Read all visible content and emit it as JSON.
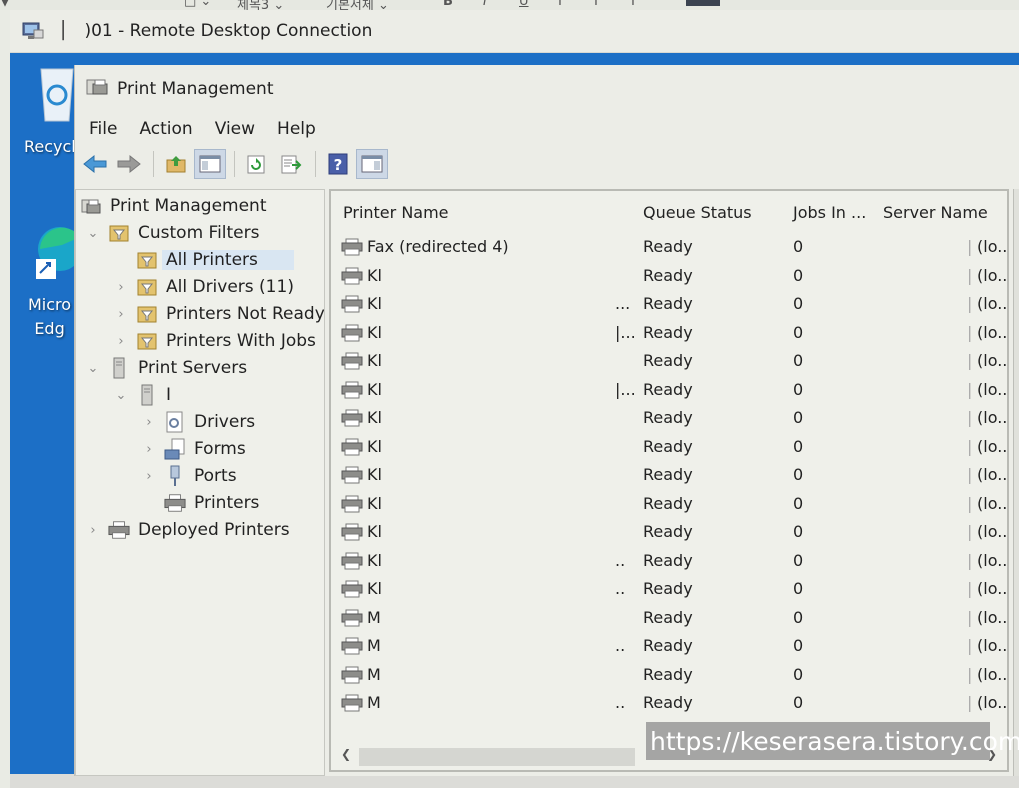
{
  "rdp": {
    "title": "│   )01 - Remote Desktop Connection"
  },
  "desktop": {
    "icons": [
      {
        "label": "Recycl"
      },
      {
        "label": "Micro\nEdg"
      }
    ]
  },
  "underlying_app": {
    "fragments": [
      "▼",
      "□ ⌄",
      "제목3 ⌄",
      "기본서체 ⌄",
      "B",
      "I",
      "U",
      "T",
      "T",
      "T"
    ]
  },
  "window": {
    "title": "Print Management",
    "menu": [
      "File",
      "Action",
      "View",
      "Help"
    ],
    "toolbar": [
      {
        "icon": "back-arrow-icon"
      },
      {
        "icon": "forward-arrow-icon"
      },
      {
        "icon": "up-folder-icon"
      },
      {
        "icon": "show-hide-console-tree-icon"
      },
      {
        "icon": "refresh-icon"
      },
      {
        "icon": "export-list-icon"
      },
      {
        "icon": "help-icon"
      },
      {
        "icon": "show-hide-action-pane-icon"
      }
    ]
  },
  "tree": [
    {
      "label": "Print Management",
      "level": 0,
      "chevron": "",
      "icon": "print-management-icon"
    },
    {
      "label": "Custom Filters",
      "level": 1,
      "chevron": "⌄",
      "icon": "filter-folder-icon"
    },
    {
      "label": "All Printers",
      "level": 2,
      "chevron": "",
      "icon": "filter-icon",
      "selected": true
    },
    {
      "label": "All Drivers (11)",
      "level": 2,
      "chevron": "›",
      "icon": "filter-icon"
    },
    {
      "label": "Printers Not Ready",
      "level": 2,
      "chevron": "›",
      "icon": "filter-icon"
    },
    {
      "label": "Printers With Jobs",
      "level": 2,
      "chevron": "›",
      "icon": "filter-icon"
    },
    {
      "label": "Print Servers",
      "level": 1,
      "chevron": "⌄",
      "icon": "server-icon"
    },
    {
      "label": "I",
      "level": 2,
      "chevron": "⌄",
      "icon": "server-icon"
    },
    {
      "label": "Drivers",
      "level": 3,
      "chevron": "›",
      "icon": "drivers-icon"
    },
    {
      "label": "Forms",
      "level": 3,
      "chevron": "›",
      "icon": "forms-icon"
    },
    {
      "label": "Ports",
      "level": 3,
      "chevron": "›",
      "icon": "ports-icon"
    },
    {
      "label": "Printers",
      "level": 3,
      "chevron": "",
      "icon": "printer-icon"
    },
    {
      "label": "Deployed Printers",
      "level": 1,
      "chevron": "›",
      "icon": "printer-icon"
    }
  ],
  "list": {
    "columns": [
      "Printer Name",
      "Queue Status",
      "Jobs In ...",
      "Server Name"
    ],
    "rows": [
      {
        "name": "Fax (redirected 4)",
        "trail": "",
        "status": "Ready",
        "jobs": "0",
        "server": "(lo..."
      },
      {
        "name": "Kl",
        "trail": "",
        "status": "Ready",
        "jobs": "0",
        "server": "(lo..."
      },
      {
        "name": "Kl",
        "trail": "...",
        "status": "Ready",
        "jobs": "0",
        "server": "(lo..."
      },
      {
        "name": "Kl",
        "trail": "|...",
        "status": "Ready",
        "jobs": "0",
        "server": "(lo..."
      },
      {
        "name": "Kl",
        "trail": "",
        "status": "Ready",
        "jobs": "0",
        "server": "(lo..."
      },
      {
        "name": "Kl",
        "trail": "|...",
        "status": "Ready",
        "jobs": "0",
        "server": "(lo..."
      },
      {
        "name": "Kl",
        "trail": "",
        "status": "Ready",
        "jobs": "0",
        "server": "(lo..."
      },
      {
        "name": "Kl",
        "trail": "",
        "status": "Ready",
        "jobs": "0",
        "server": "(lo..."
      },
      {
        "name": "Kl",
        "trail": "",
        "status": "Ready",
        "jobs": "0",
        "server": "(lo..."
      },
      {
        "name": "Kl",
        "trail": "",
        "status": "Ready",
        "jobs": "0",
        "server": "(lo..."
      },
      {
        "name": "Kl",
        "trail": "",
        "status": "Ready",
        "jobs": "0",
        "server": "(lo..."
      },
      {
        "name": "Kl",
        "trail": "..",
        "status": "Ready",
        "jobs": "0",
        "server": "(lo..."
      },
      {
        "name": "Kl",
        "trail": "..",
        "status": "Ready",
        "jobs": "0",
        "server": "(lo..."
      },
      {
        "name": "M",
        "trail": "",
        "status": "Ready",
        "jobs": "0",
        "server": "(lo..."
      },
      {
        "name": "M",
        "trail": "..",
        "status": "Ready",
        "jobs": "0",
        "server": "(lo..."
      },
      {
        "name": "M",
        "trail": "",
        "status": "Ready",
        "jobs": "0",
        "server": "(lo..."
      },
      {
        "name": "M",
        "trail": "..",
        "status": "Ready",
        "jobs": "0",
        "server": "(lo..."
      }
    ]
  },
  "watermark": "https://keserasera.tistory.com"
}
